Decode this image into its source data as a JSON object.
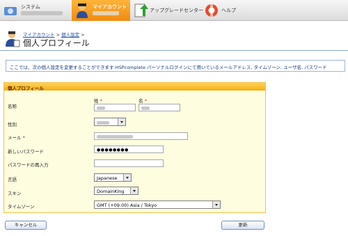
{
  "nav": {
    "system": {
      "label": "システム"
    },
    "my_account": {
      "label": "マイアカウント"
    },
    "upgrade_center": {
      "label": "アップグレードセンター"
    },
    "help": {
      "label": "ヘルプ"
    }
  },
  "breadcrumb": {
    "my_account": "マイアカウント",
    "separator_1": " > ",
    "personal_settings": "個人設定",
    "separator_2": " >"
  },
  "page": {
    "title": "個人プロフィール"
  },
  "info_text": "ここでは、次の個人設定を変更することができます:HSPcomplete パーソナルログインにて用いているメールアドレス, タイムゾーン, ユーザ名, パスワード",
  "panel": {
    "title": "個人プロフィール"
  },
  "form": {
    "name_label": "名称",
    "last_name_label": "姓",
    "first_name_label": "名",
    "required_mark": "*",
    "gender_label": "性別",
    "email_label": "メール",
    "new_password_label": "新しいパスワード",
    "password_value": "●●●●●●●●",
    "password_confirm_label": "パスワードの再入力",
    "language_label": "言語",
    "language_value": "Japanese",
    "skin_label": "スキン",
    "skin_value": "DomainKing",
    "timezone_label": "タイムゾーン",
    "timezone_value": "GMT (+09:00) Asia / Tokyo"
  },
  "buttons": {
    "cancel": "キャンセル",
    "update": "更新"
  },
  "colors": {
    "nav_active": "#f08a10",
    "panel_bg": "#fffde0",
    "panel_header": "#f6ad10",
    "link": "#1a4ba8"
  }
}
